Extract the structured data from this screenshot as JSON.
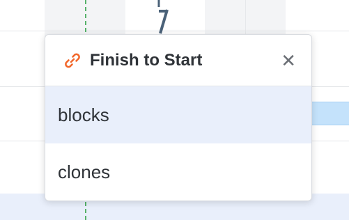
{
  "popup": {
    "title": "Finish to Start",
    "close_label": "✕",
    "options": [
      {
        "label": "blocks",
        "selected": true
      },
      {
        "label": "clones",
        "selected": false
      }
    ]
  },
  "icons": {
    "header": "link-icon",
    "close": "close-icon"
  },
  "colors": {
    "link_icon": "#f2672a",
    "today_line": "#57b26b",
    "selected_option_bg": "#e9effb",
    "task_bar": "#c4e2fb"
  }
}
